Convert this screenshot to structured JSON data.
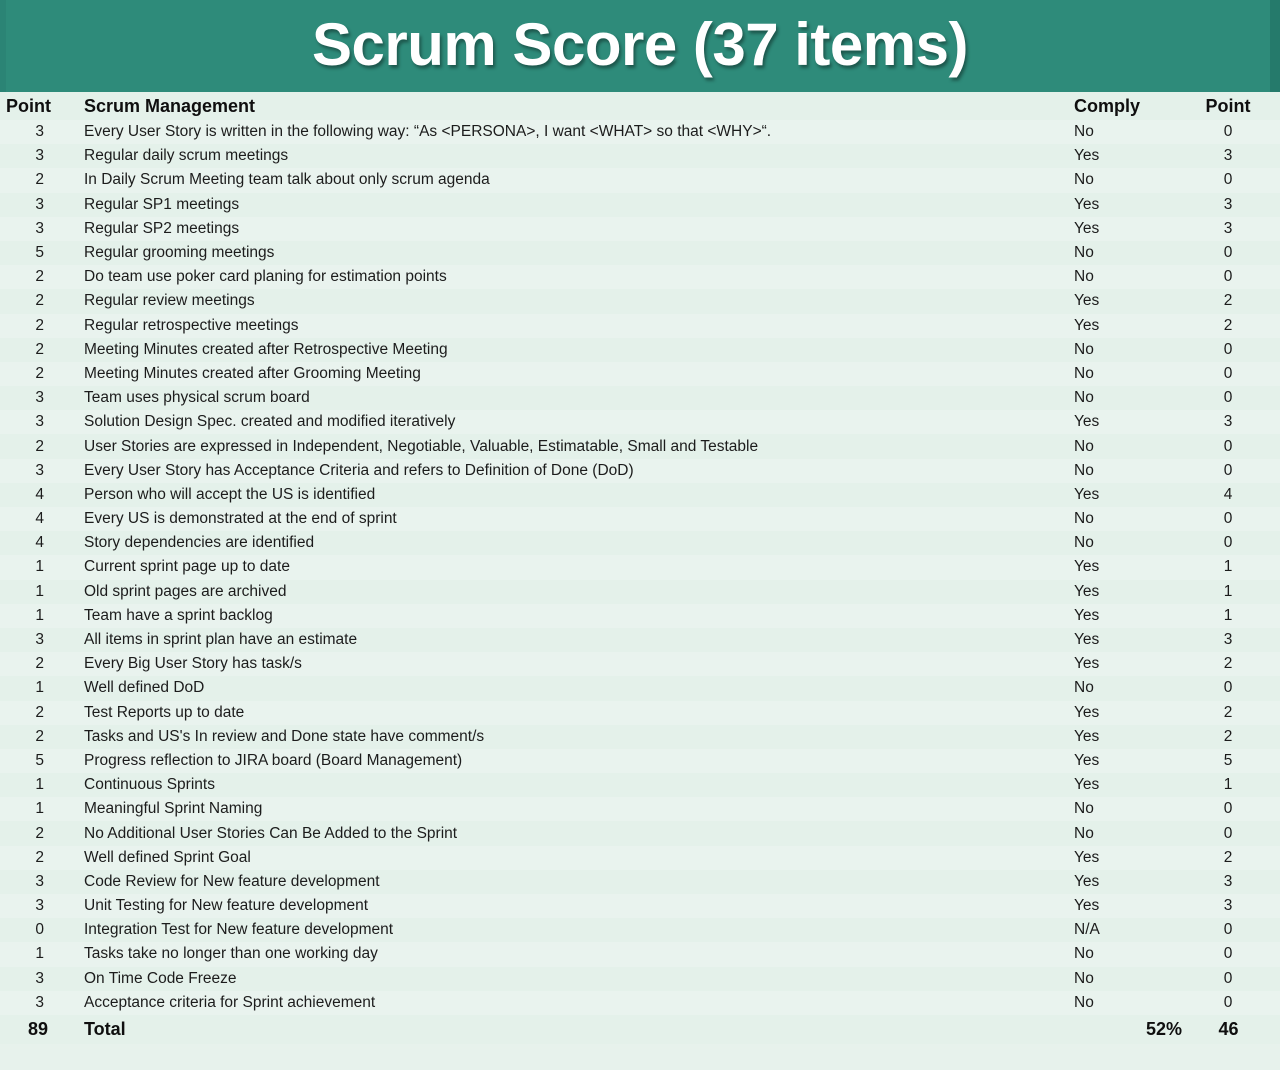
{
  "banner": {
    "title": "Scrum Score (37 items)",
    "background_color": "#2e8b7a",
    "text_color": "#ffffff"
  },
  "table": {
    "columns": {
      "point_left": "Point",
      "description": "Scrum Management",
      "comply": "Comply",
      "point_right": "Point"
    },
    "rows": [
      {
        "point": "3",
        "desc": "Every User Story is written in the following way: “As <PERSONA>, I want <WHAT> so that <WHY>“.",
        "comply": "No",
        "score": "0"
      },
      {
        "point": "3",
        "desc": "Regular daily scrum meetings",
        "comply": "Yes",
        "score": "3"
      },
      {
        "point": "2",
        "desc": "In Daily Scrum Meeting team talk about only scrum agenda",
        "comply": "No",
        "score": "0"
      },
      {
        "point": "3",
        "desc": "Regular SP1 meetings",
        "comply": "Yes",
        "score": "3"
      },
      {
        "point": "3",
        "desc": "Regular SP2 meetings",
        "comply": "Yes",
        "score": "3"
      },
      {
        "point": "5",
        "desc": "Regular grooming meetings",
        "comply": "No",
        "score": "0"
      },
      {
        "point": "2",
        "desc": "Do team use poker card planing for estimation points",
        "comply": "No",
        "score": "0"
      },
      {
        "point": "2",
        "desc": "Regular review meetings",
        "comply": "Yes",
        "score": "2"
      },
      {
        "point": "2",
        "desc": "Regular retrospective meetings",
        "comply": "Yes",
        "score": "2"
      },
      {
        "point": "2",
        "desc": "Meeting Minutes created after Retrospective Meeting",
        "comply": "No",
        "score": "0"
      },
      {
        "point": "2",
        "desc": "Meeting Minutes created after Grooming Meeting",
        "comply": "No",
        "score": "0"
      },
      {
        "point": "3",
        "desc": "Team uses physical scrum board",
        "comply": "No",
        "score": "0"
      },
      {
        "point": "3",
        "desc": "Solution Design Spec. created and modified iteratively",
        "comply": "Yes",
        "score": "3"
      },
      {
        "point": "2",
        "desc": "User Stories are expressed in Independent, Negotiable, Valuable, Estimatable, Small and Testable",
        "comply": "No",
        "score": "0"
      },
      {
        "point": "3",
        "desc": "Every User Story has Acceptance Criteria and refers to Definition of Done (DoD)",
        "comply": "No",
        "score": "0"
      },
      {
        "point": "4",
        "desc": "Person who will accept the US is identified",
        "comply": "Yes",
        "score": "4"
      },
      {
        "point": "4",
        "desc": "Every US is demonstrated at the end of sprint",
        "comply": "No",
        "score": "0"
      },
      {
        "point": "4",
        "desc": "Story dependencies are identified",
        "comply": "No",
        "score": "0"
      },
      {
        "point": "1",
        "desc": "Current sprint page up to date",
        "comply": "Yes",
        "score": "1"
      },
      {
        "point": "1",
        "desc": "Old sprint pages are archived",
        "comply": "Yes",
        "score": "1"
      },
      {
        "point": "1",
        "desc": "Team have a sprint backlog",
        "comply": "Yes",
        "score": "1"
      },
      {
        "point": "3",
        "desc": "All items in sprint plan have an estimate",
        "comply": "Yes",
        "score": "3"
      },
      {
        "point": "2",
        "desc": "Every Big User Story has task/s",
        "comply": "Yes",
        "score": "2"
      },
      {
        "point": "1",
        "desc": "Well defined DoD",
        "comply": "No",
        "score": "0"
      },
      {
        "point": "2",
        "desc": "Test Reports up to date",
        "comply": "Yes",
        "score": "2"
      },
      {
        "point": "2",
        "desc": "Tasks and US's In review and Done state have comment/s",
        "comply": "Yes",
        "score": "2"
      },
      {
        "point": "5",
        "desc": "Progress reflection to JIRA board (Board Management)",
        "comply": "Yes",
        "score": "5"
      },
      {
        "point": "1",
        "desc": "Continuous Sprints",
        "comply": "Yes",
        "score": "1"
      },
      {
        "point": "1",
        "desc": "Meaningful Sprint Naming",
        "comply": "No",
        "score": "0"
      },
      {
        "point": "2",
        "desc": "No Additional User Stories Can Be Added to the Sprint",
        "comply": "No",
        "score": "0"
      },
      {
        "point": "2",
        "desc": "Well defined Sprint Goal",
        "comply": "Yes",
        "score": "2"
      },
      {
        "point": "3",
        "desc": "Code Review for New feature development",
        "comply": "Yes",
        "score": "3"
      },
      {
        "point": "3",
        "desc": "Unit Testing for New feature development",
        "comply": "Yes",
        "score": "3"
      },
      {
        "point": "0",
        "desc": "Integration Test for New feature development",
        "comply": "N/A",
        "score": "0"
      },
      {
        "point": "1",
        "desc": "Tasks take no longer than one working day",
        "comply": "No",
        "score": "0"
      },
      {
        "point": "3",
        "desc": "On Time Code Freeze",
        "comply": "No",
        "score": "0"
      },
      {
        "point": "3",
        "desc": "Acceptance criteria for Sprint achievement",
        "comply": "No",
        "score": "0"
      }
    ],
    "total": {
      "point": "89",
      "label": "Total",
      "percent": "52%",
      "score": "46"
    }
  }
}
